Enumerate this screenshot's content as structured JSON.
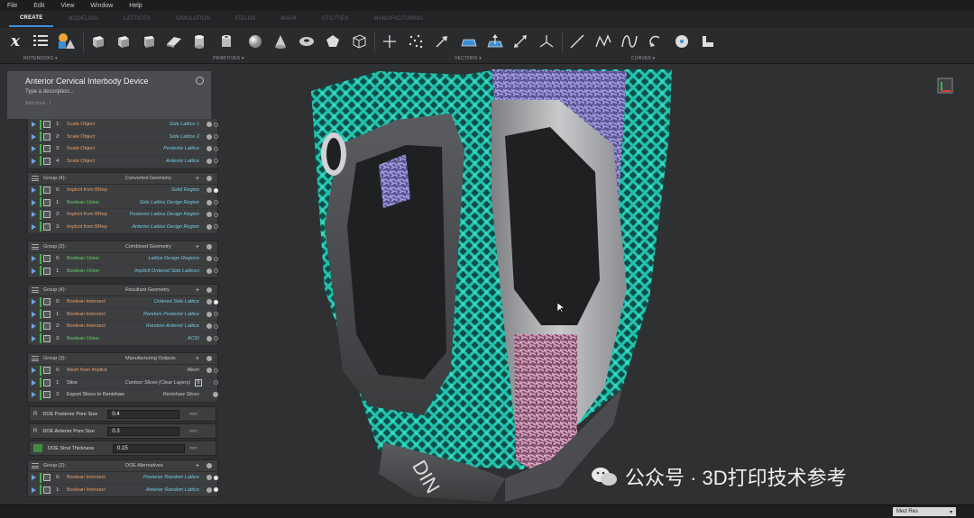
{
  "menu": [
    "File",
    "Edit",
    "View",
    "Window",
    "Help"
  ],
  "tabs": [
    "CREATE",
    "MODELING",
    "LATTICES",
    "SIMULATION",
    "FIELDS",
    "MATH",
    "UTILITIES",
    "MANUFACTURING"
  ],
  "toolbar": {
    "notebooks_label": "NOTEBOOKS ▾",
    "primitives_label": "PRIMITIVES ▾",
    "vectors_label": "VECTORS ▾",
    "curves_label": "CURVES ▾"
  },
  "panel": {
    "title": "Anterior Cervical Interbody Device",
    "description": "Type a description...",
    "meta": "Add block · 1"
  },
  "top_rows": [
    {
      "idx": "1:",
      "op": "Scale Object",
      "out": "Side Lattice 1"
    },
    {
      "idx": "2:",
      "op": "Scale Object",
      "out": "Side Lattice 2"
    },
    {
      "idx": "3:",
      "op": "Scale Object",
      "out": "Posterior Lattice"
    },
    {
      "idx": "4:",
      "op": "Scale Object",
      "out": "Anterior Lattice"
    }
  ],
  "groups": [
    {
      "header": "Group (4):",
      "name": "Converted Geometry",
      "rows": [
        {
          "idx": "0:",
          "op": "Implicit from BRep",
          "out": "Solid Region"
        },
        {
          "idx": "1:",
          "op": "Boolean Union",
          "out": "Side Lattice Design Region"
        },
        {
          "idx": "2:",
          "op": "Implicit from BRep",
          "out": "Posterior Lattice Design Region"
        },
        {
          "idx": "3:",
          "op": "Implicit from BRep",
          "out": "Anterior Lattice Design Region"
        }
      ]
    },
    {
      "header": "Group (2):",
      "name": "Combined Geometry",
      "rows": [
        {
          "idx": "0:",
          "op": "Boolean Union",
          "out": "Lattice Design Regions"
        },
        {
          "idx": "1:",
          "op": "Boolean Union",
          "out": "Implicit Ordered Side Lattices"
        }
      ]
    },
    {
      "header": "Group (4):",
      "name": "Resultant Geometry",
      "rows": [
        {
          "idx": "0:",
          "op": "Boolean Intersect",
          "out": "Ordered Side Lattice"
        },
        {
          "idx": "1:",
          "op": "Boolean Intersect",
          "out": "Random Posterior Lattice"
        },
        {
          "idx": "2:",
          "op": "Boolean Intersect",
          "out": "Random Anterior Lattice"
        },
        {
          "idx": "3:",
          "op": "Boolean Union",
          "out": "ACID"
        }
      ]
    },
    {
      "header": "Group (3):",
      "name": "Manufacturing Outputs",
      "rows": [
        {
          "idx": "0:",
          "op": "Mesh from Implicit",
          "out": "Mesh"
        },
        {
          "idx": "1:",
          "op": "Slice",
          "out": "Contour Slices (Clear Layers)"
        },
        {
          "idx": "2:",
          "op": "Export Slices to Renishaw",
          "out": "Renishaw Slices"
        }
      ]
    }
  ],
  "params": [
    {
      "label": "DOE Posterior Pore Size",
      "value": "0.4",
      "unit": "mm"
    },
    {
      "label": "DOE Anterior Pore Size",
      "value": "0.3",
      "unit": "mm"
    },
    {
      "label": "DOE Strut Thickness",
      "value": "0.15",
      "unit": "mm"
    }
  ],
  "doe_group": {
    "header": "Group (2):",
    "name": "DOE Alternatives",
    "rows": [
      {
        "idx": "0:",
        "op": "Boolean Intersect",
        "out": "Posterior Random Lattice"
      },
      {
        "idx": "1:",
        "op": "Boolean Intersect",
        "out": "Anterior Random Lattice"
      }
    ]
  },
  "status": {
    "resolution": "Med Res"
  },
  "watermark": "公众号 · 3D打印技术参考",
  "colors": {
    "lattice_teal": "#1fb5a3",
    "lattice_purple": "#8e86c9",
    "lattice_pink": "#c48aa9",
    "frame_gray": "#b9bbbd",
    "accent": "#3b8fd8"
  }
}
